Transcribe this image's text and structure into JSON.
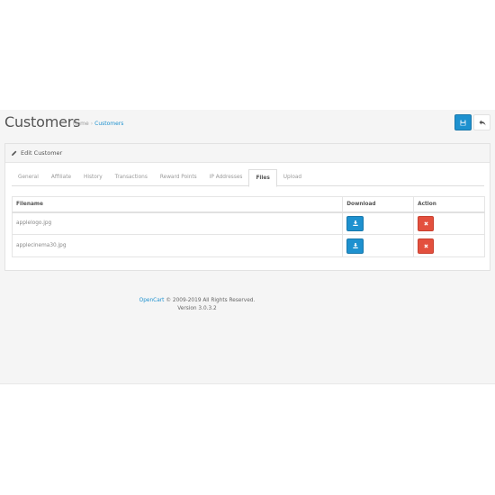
{
  "header": {
    "title": "Customers",
    "breadcrumb": [
      {
        "label": "Home"
      },
      {
        "label": "Customers"
      }
    ],
    "separator": "›",
    "save_icon": "save-icon",
    "back_icon": "reply-icon"
  },
  "panel": {
    "icon": "pencil-icon",
    "title": "Edit Customer"
  },
  "tabs": [
    {
      "label": "General",
      "active": false
    },
    {
      "label": "Affiliate",
      "active": false
    },
    {
      "label": "History",
      "active": false
    },
    {
      "label": "Transactions",
      "active": false
    },
    {
      "label": "Reward Points",
      "active": false
    },
    {
      "label": "IP Addresses",
      "active": false
    },
    {
      "label": "Files",
      "active": true
    },
    {
      "label": "Upload",
      "active": false
    }
  ],
  "table": {
    "columns": [
      "Filename",
      "Download",
      "Action"
    ],
    "rows": [
      {
        "filename": "applelogo.jpg",
        "download_icon": "download-icon",
        "action_icon": "remove-icon"
      },
      {
        "filename": "applecinema30.jpg",
        "download_icon": "download-icon",
        "action_icon": "remove-icon"
      }
    ]
  },
  "footer": {
    "brand": "OpenCart",
    "copyright": " © 2009-2019 All Rights Reserved.",
    "version": "Version 3.0.3.2"
  },
  "colors": {
    "primary": "#1e91cf",
    "danger": "#e3503e",
    "background": "#f5f5f5"
  }
}
